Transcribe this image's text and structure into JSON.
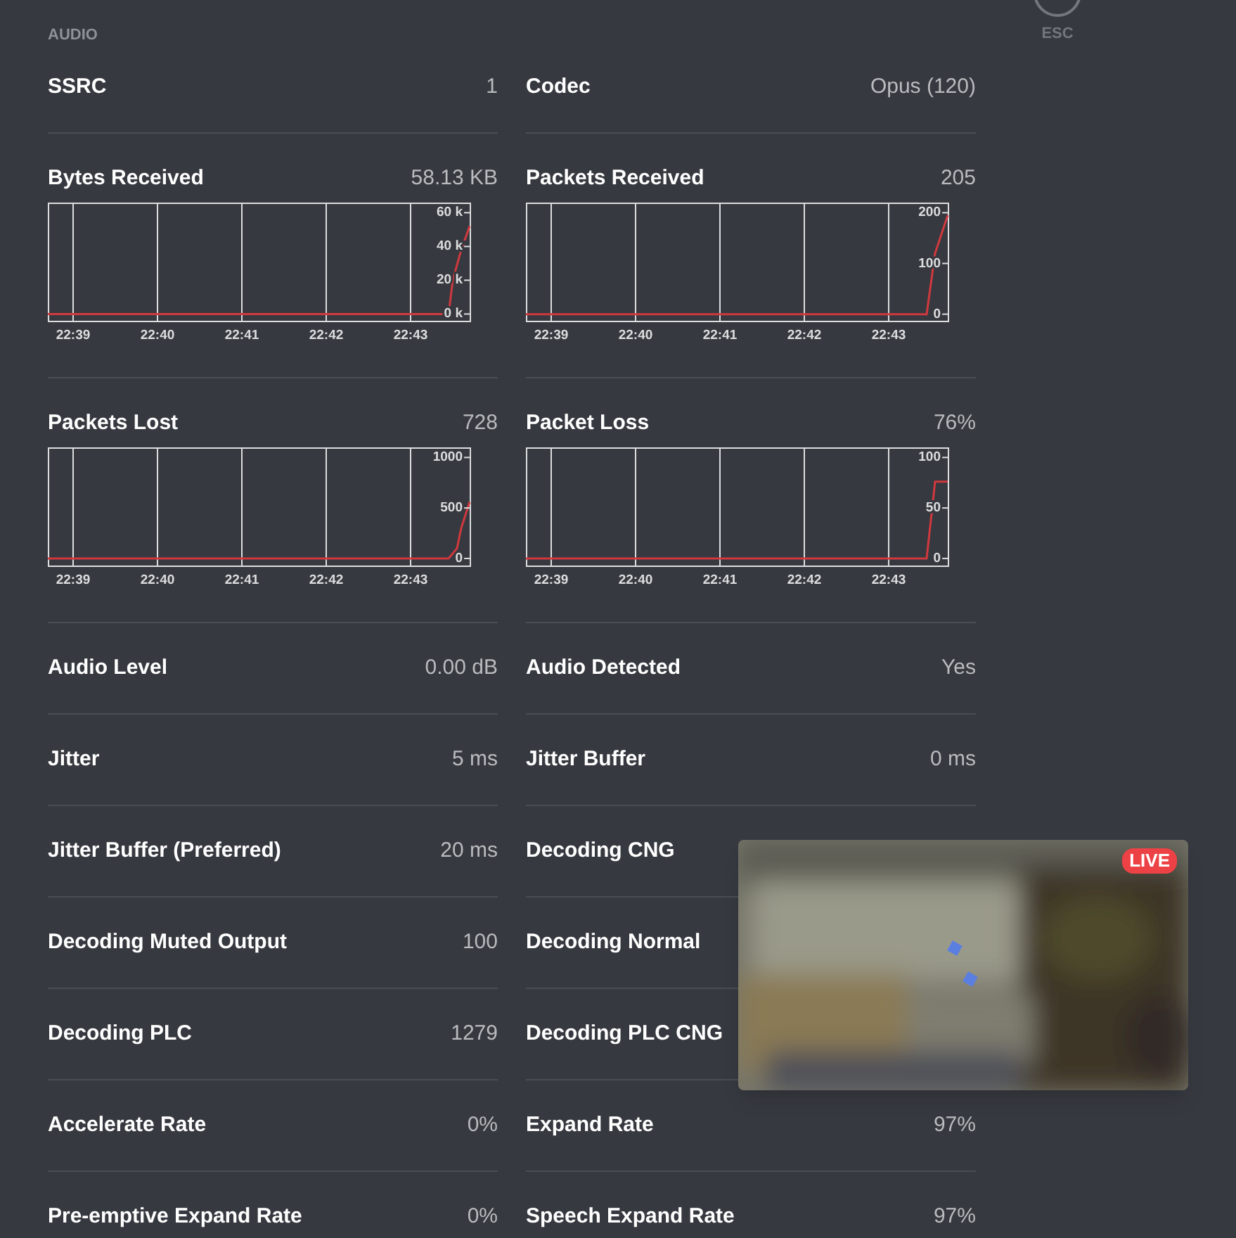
{
  "section_label": "AUDIO",
  "close": {
    "label": "ESC"
  },
  "rows": [
    [
      {
        "kind": "stat",
        "label": "SSRC",
        "value": "1"
      },
      {
        "kind": "stat",
        "label": "Codec",
        "value": "Opus (120)"
      }
    ],
    [
      {
        "kind": "chart",
        "label": "Bytes Received",
        "value": "58.13 KB",
        "chart_data": {
          "type": "line",
          "xlim": [
            1358.7,
            1363.7
          ],
          "grid": true,
          "ylim": [
            -4000,
            66000
          ],
          "xticks": [
            {
              "value": 1359,
              "label": "22:39"
            },
            {
              "value": 1360,
              "label": "22:40"
            },
            {
              "value": 1361,
              "label": "22:41"
            },
            {
              "value": 1362,
              "label": "22:42"
            },
            {
              "value": 1363,
              "label": "22:43"
            }
          ],
          "yticks": [
            {
              "value": 0,
              "label": "0 k"
            },
            {
              "value": 20000,
              "label": "20 k"
            },
            {
              "value": 40000,
              "label": "40 k"
            },
            {
              "value": 60000,
              "label": "60 k"
            }
          ],
          "x": [
            1358.7,
            1363.45,
            1363.5,
            1363.6,
            1363.7
          ],
          "series": [
            {
              "color": "#d0393e",
              "values": [
                0,
                0,
                20000,
                38000,
                52000
              ]
            }
          ]
        }
      },
      {
        "kind": "chart",
        "label": "Packets Received",
        "value": "205",
        "chart_data": {
          "type": "line",
          "xlim": [
            1358.7,
            1363.7
          ],
          "grid": true,
          "ylim": [
            -13,
            220
          ],
          "xticks": [
            {
              "value": 1359,
              "label": "22:39"
            },
            {
              "value": 1360,
              "label": "22:40"
            },
            {
              "value": 1361,
              "label": "22:41"
            },
            {
              "value": 1362,
              "label": "22:42"
            },
            {
              "value": 1363,
              "label": "22:43"
            }
          ],
          "yticks": [
            0,
            100,
            200
          ],
          "x": [
            1358.7,
            1363.45,
            1363.55,
            1363.7
          ],
          "series": [
            {
              "color": "#d0393e",
              "values": [
                0,
                0,
                120,
                195
              ]
            }
          ]
        }
      }
    ],
    [
      {
        "kind": "chart",
        "label": "Packets Lost",
        "value": "728",
        "chart_data": {
          "type": "line",
          "xlim": [
            1358.7,
            1363.7
          ],
          "grid": true,
          "ylim": [
            -70,
            1100
          ],
          "xticks": [
            {
              "value": 1359,
              "label": "22:39"
            },
            {
              "value": 1360,
              "label": "22:40"
            },
            {
              "value": 1361,
              "label": "22:41"
            },
            {
              "value": 1362,
              "label": "22:42"
            },
            {
              "value": 1363,
              "label": "22:43"
            }
          ],
          "yticks": [
            0,
            500,
            1000
          ],
          "x": [
            1358.7,
            1363.45,
            1363.55,
            1363.6,
            1363.7
          ],
          "series": [
            {
              "color": "#d0393e",
              "values": [
                0,
                0,
                100,
                300,
                560
              ]
            }
          ]
        }
      },
      {
        "kind": "chart",
        "label": "Packet Loss",
        "value": "76%",
        "chart_data": {
          "type": "line",
          "xlim": [
            1358.7,
            1363.7
          ],
          "grid": true,
          "ylim": [
            -7,
            110
          ],
          "xticks": [
            {
              "value": 1359,
              "label": "22:39"
            },
            {
              "value": 1360,
              "label": "22:40"
            },
            {
              "value": 1361,
              "label": "22:41"
            },
            {
              "value": 1362,
              "label": "22:42"
            },
            {
              "value": 1363,
              "label": "22:43"
            }
          ],
          "yticks": [
            0,
            50,
            100
          ],
          "x": [
            1358.7,
            1363.45,
            1363.55,
            1363.7
          ],
          "series": [
            {
              "color": "#d0393e",
              "values": [
                0,
                0,
                76,
                76
              ]
            }
          ]
        }
      }
    ],
    [
      {
        "kind": "stat",
        "label": "Audio Level",
        "value": "0.00 dB"
      },
      {
        "kind": "stat",
        "label": "Audio Detected",
        "value": "Yes"
      }
    ],
    [
      {
        "kind": "stat",
        "label": "Jitter",
        "value": "5 ms"
      },
      {
        "kind": "stat",
        "label": "Jitter Buffer",
        "value": "0 ms"
      }
    ],
    [
      {
        "kind": "stat",
        "label": "Jitter Buffer (Preferred)",
        "value": "20 ms"
      },
      {
        "kind": "stat",
        "label": "Decoding CNG"
      }
    ],
    [
      {
        "kind": "stat",
        "label": "Decoding Muted Output",
        "value": "100"
      },
      {
        "kind": "stat",
        "label": "Decoding Normal"
      }
    ],
    [
      {
        "kind": "stat",
        "label": "Decoding PLC",
        "value": "1279"
      },
      {
        "kind": "stat",
        "label": "Decoding PLC CNG"
      }
    ],
    [
      {
        "kind": "stat",
        "label": "Accelerate Rate",
        "value": "0%"
      },
      {
        "kind": "stat",
        "label": "Expand Rate",
        "value": "97%"
      }
    ],
    [
      {
        "kind": "stat",
        "label": "Pre-emptive Expand Rate",
        "value": "0%"
      },
      {
        "kind": "stat",
        "label": "Speech Expand Rate",
        "value": "97%"
      }
    ]
  ],
  "video": {
    "kind": "picture",
    "badge": "LIVE"
  }
}
